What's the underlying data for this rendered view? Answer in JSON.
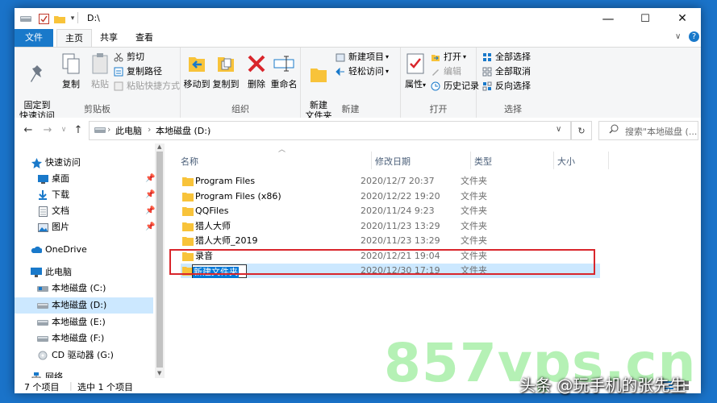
{
  "window": {
    "title": "D:\\",
    "controls": {
      "minimize": "—",
      "maximize": "☐",
      "close": "✕"
    }
  },
  "ribbon_tabs": {
    "file": "文件",
    "home": "主页",
    "share": "共享",
    "view": "查看"
  },
  "ribbon": {
    "clipboard": {
      "pin_quick_access": "固定到\n快速访问",
      "copy": "复制",
      "paste": "粘贴",
      "cut": "剪切",
      "copy_path": "复制路径",
      "paste_shortcut": "粘贴快捷方式",
      "label": "剪贴板"
    },
    "organize": {
      "move_to": "移动到",
      "copy_to": "复制到",
      "delete": "删除",
      "rename": "重命名",
      "label": "组织"
    },
    "new": {
      "new_folder": "新建\n文件夹",
      "new_item": "新建项目",
      "easy_access": "轻松访问",
      "label": "新建"
    },
    "open": {
      "properties": "属性",
      "open": "打开",
      "edit": "编辑",
      "history": "历史记录",
      "label": "打开"
    },
    "select": {
      "select_all": "全部选择",
      "select_none": "全部取消",
      "invert": "反向选择",
      "label": "选择"
    }
  },
  "address": {
    "crumbs": [
      "此电脑",
      "本地磁盘 (D:)"
    ],
    "search_placeholder": "搜索\"本地磁盘 (..."
  },
  "nav_pane": {
    "quick_access": "快速访问",
    "quick_items": [
      "桌面",
      "下载",
      "文档",
      "图片"
    ],
    "onedrive": "OneDrive",
    "this_pc": "此电脑",
    "drives": [
      "本地磁盘 (C:)",
      "本地磁盘 (D:)",
      "本地磁盘 (E:)",
      "本地磁盘 (F:)",
      "CD 驱动器 (G:)"
    ],
    "network": "网络"
  },
  "file_list": {
    "columns": {
      "name": "名称",
      "date": "修改日期",
      "type": "类型",
      "size": "大小"
    },
    "rows": [
      {
        "name": "Program Files",
        "date": "2020/12/7 20:37",
        "type": "文件夹"
      },
      {
        "name": "Program Files (x86)",
        "date": "2020/12/22 19:20",
        "type": "文件夹"
      },
      {
        "name": "QQFiles",
        "date": "2020/11/24 9:23",
        "type": "文件夹"
      },
      {
        "name": "猎人大师",
        "date": "2020/11/23 13:29",
        "type": "文件夹"
      },
      {
        "name": "猎人大师_2019",
        "date": "2020/11/23 13:29",
        "type": "文件夹"
      },
      {
        "name": "录音",
        "date": "2020/12/21 19:04",
        "type": "文件夹"
      },
      {
        "name": "新建文件夹",
        "date": "2020/12/30 17:19",
        "type": "文件夹"
      }
    ]
  },
  "status": {
    "count": "7 个项目",
    "selected": "选中 1 个项目"
  },
  "watermark": {
    "site": "857vps.cn",
    "author": "头条 @玩手机的张先生"
  },
  "colors": {
    "accent": "#1979ca",
    "selection": "#cce8ff",
    "highlight": "#d9262c",
    "folder": "#f8c33a"
  }
}
